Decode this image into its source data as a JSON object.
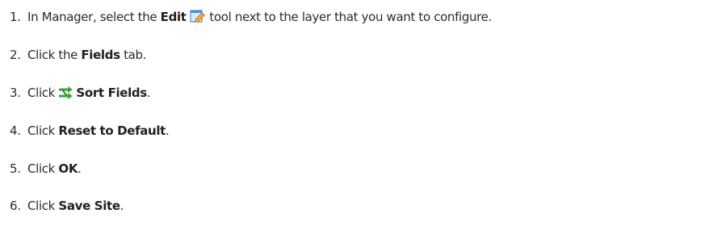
{
  "steps": [
    {
      "number": "1.",
      "text_before": "In Manager, select the",
      "bold": "Edit",
      "icon": "edit-pencil-icon",
      "text_after": "tool next to the layer that you want to configure."
    },
    {
      "number": "2.",
      "text_before": "Click the",
      "bold": "Fields",
      "text_after": "tab."
    },
    {
      "number": "3.",
      "text_before": "Click",
      "icon": "sort-fields-icon",
      "bold": "Sort Fields",
      "text_after": "."
    },
    {
      "number": "4.",
      "text_before": "Click",
      "bold": "Reset to Default",
      "text_after": "."
    },
    {
      "number": "5.",
      "text_before": "Click",
      "bold": "OK",
      "text_after": "."
    },
    {
      "number": "6.",
      "text_before": "Click",
      "bold": "Save Site",
      "text_after": "."
    }
  ],
  "colors": {
    "text": "#2b2b2b",
    "sort_icon_green": "#3aa63a",
    "edit_icon_blue": "#4a8fd8",
    "edit_icon_pencil": "#f0b030"
  }
}
